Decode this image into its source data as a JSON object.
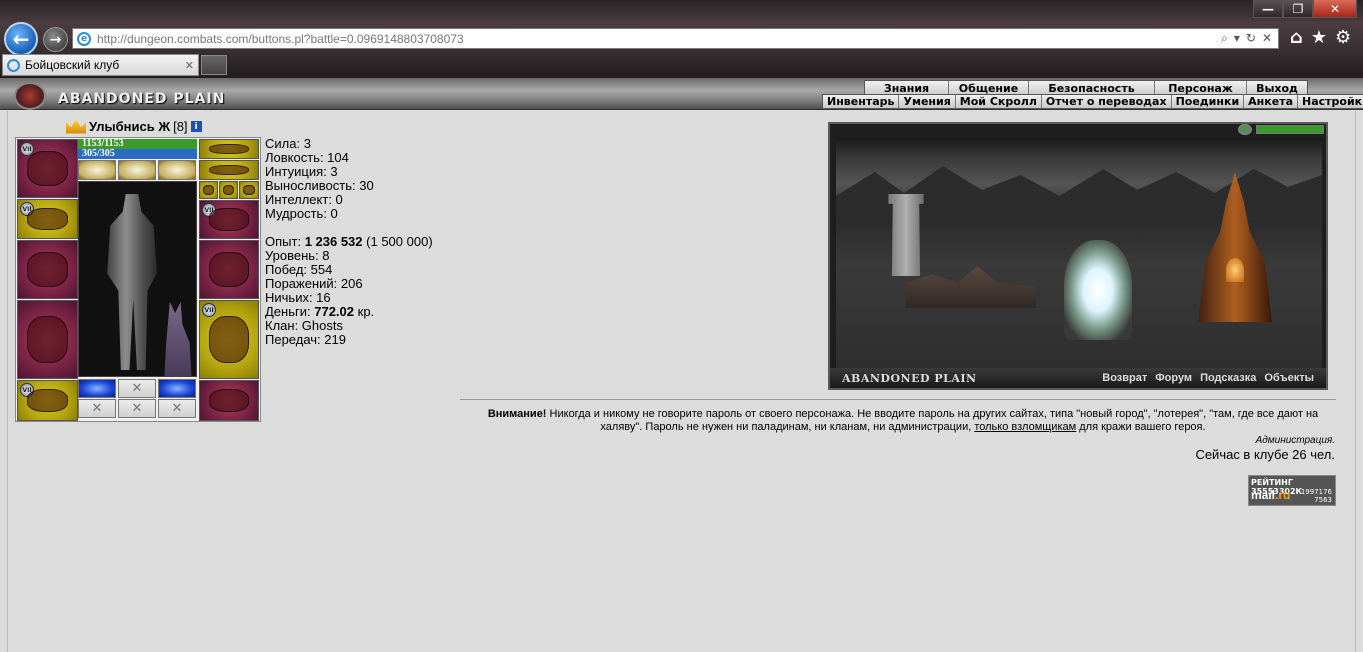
{
  "browser": {
    "url": "http://dungeon.combats.com/buttons.pl?battle=0.0969148803708073",
    "tab_title": "Бойцовский клуб",
    "tab_close": "✕",
    "win_minimize": "—",
    "win_maximize": "❐",
    "win_close": "✕",
    "back": "←",
    "forward": "→",
    "address_tools": [
      "⌕",
      "▾",
      "↻",
      "✕"
    ],
    "right_tools": [
      "⌂",
      "★",
      "⚙"
    ]
  },
  "game_header": {
    "title": "ABANDONED PLAIN",
    "main_menu": [
      "Знания",
      "Общение",
      "Безопасность",
      "Персонаж",
      "Выход"
    ],
    "sub_menu": [
      "Инвентарь",
      "Умения",
      "Мой Скролл",
      "Отчет о переводах",
      "Поединки",
      "Анкета",
      "Настройки"
    ]
  },
  "character": {
    "name": "Улыбнись Ж",
    "level": "[8]",
    "info_icon": "i",
    "hp_text": "1153/1153",
    "mana_text": "305/305",
    "slot_badge": "VII",
    "rune_glyph": "✕"
  },
  "stats": {
    "strength": "Сила: 3",
    "agility": "Ловкость: 104",
    "intuition": "Интуиция: 3",
    "endurance": "Выносливость: 30",
    "intellect": "Интеллект: 0",
    "wisdom": "Мудрость: 0",
    "exp_label": "Опыт:",
    "exp_value": "1 236 532",
    "exp_next": "(1 500 000)",
    "level": "Уровень: 8",
    "wins": "Побед: 554",
    "losses": "Поражений: 206",
    "draws": "Ничьих: 16",
    "money_label": "Деньги:",
    "money_value": "772.02",
    "money_unit": "кр.",
    "clan": "Клан: Ghosts",
    "transfers": "Передач: 219"
  },
  "location": {
    "name": "ABANDONED PLAIN",
    "links": [
      "Возврат",
      "Форум",
      "Подсказка",
      "Объекты"
    ]
  },
  "warning": {
    "bold": "Внимание!",
    "text1": " Никогда и никому не говорите пароль от своего персонажа. Не вводите пароль на других сайтах, типа \"новый город\", \"лотерея\", \"там, где все дают на халяву\". Пароль не нужен ни паладинам, ни кланам, ни администрации, ",
    "underline": "только взломщикам",
    "text2": " для кражи вашего героя.",
    "signature": "Администрация."
  },
  "online": "Сейчас в клубе 26 чел.",
  "rating": {
    "label": "РЕЙТИНГ 35553302К",
    "logo_main": "mail",
    "logo_accent": ".ru",
    "num1": "1997176",
    "num2": "7563"
  }
}
